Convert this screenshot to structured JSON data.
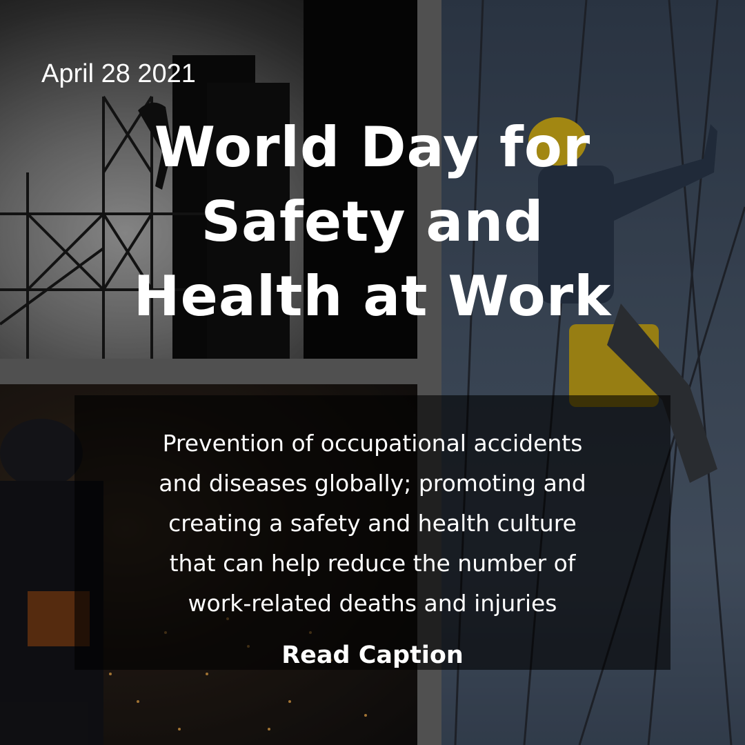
{
  "date": "April 28 2021",
  "title": {
    "lines": [
      "World Day for",
      "Safety and",
      "Health at Work"
    ]
  },
  "caption": {
    "lines": [
      "Prevention of occupational accidents",
      "and diseases globally; promoting and",
      "creating a safety and health culture",
      "that can help reduce the number of",
      "work-related deaths and injuries"
    ]
  },
  "cta": "Read Caption",
  "colors": {
    "text": "#ffffff",
    "frame": "#737373",
    "overlay": "#000000",
    "helmet": "#e8c21a"
  }
}
